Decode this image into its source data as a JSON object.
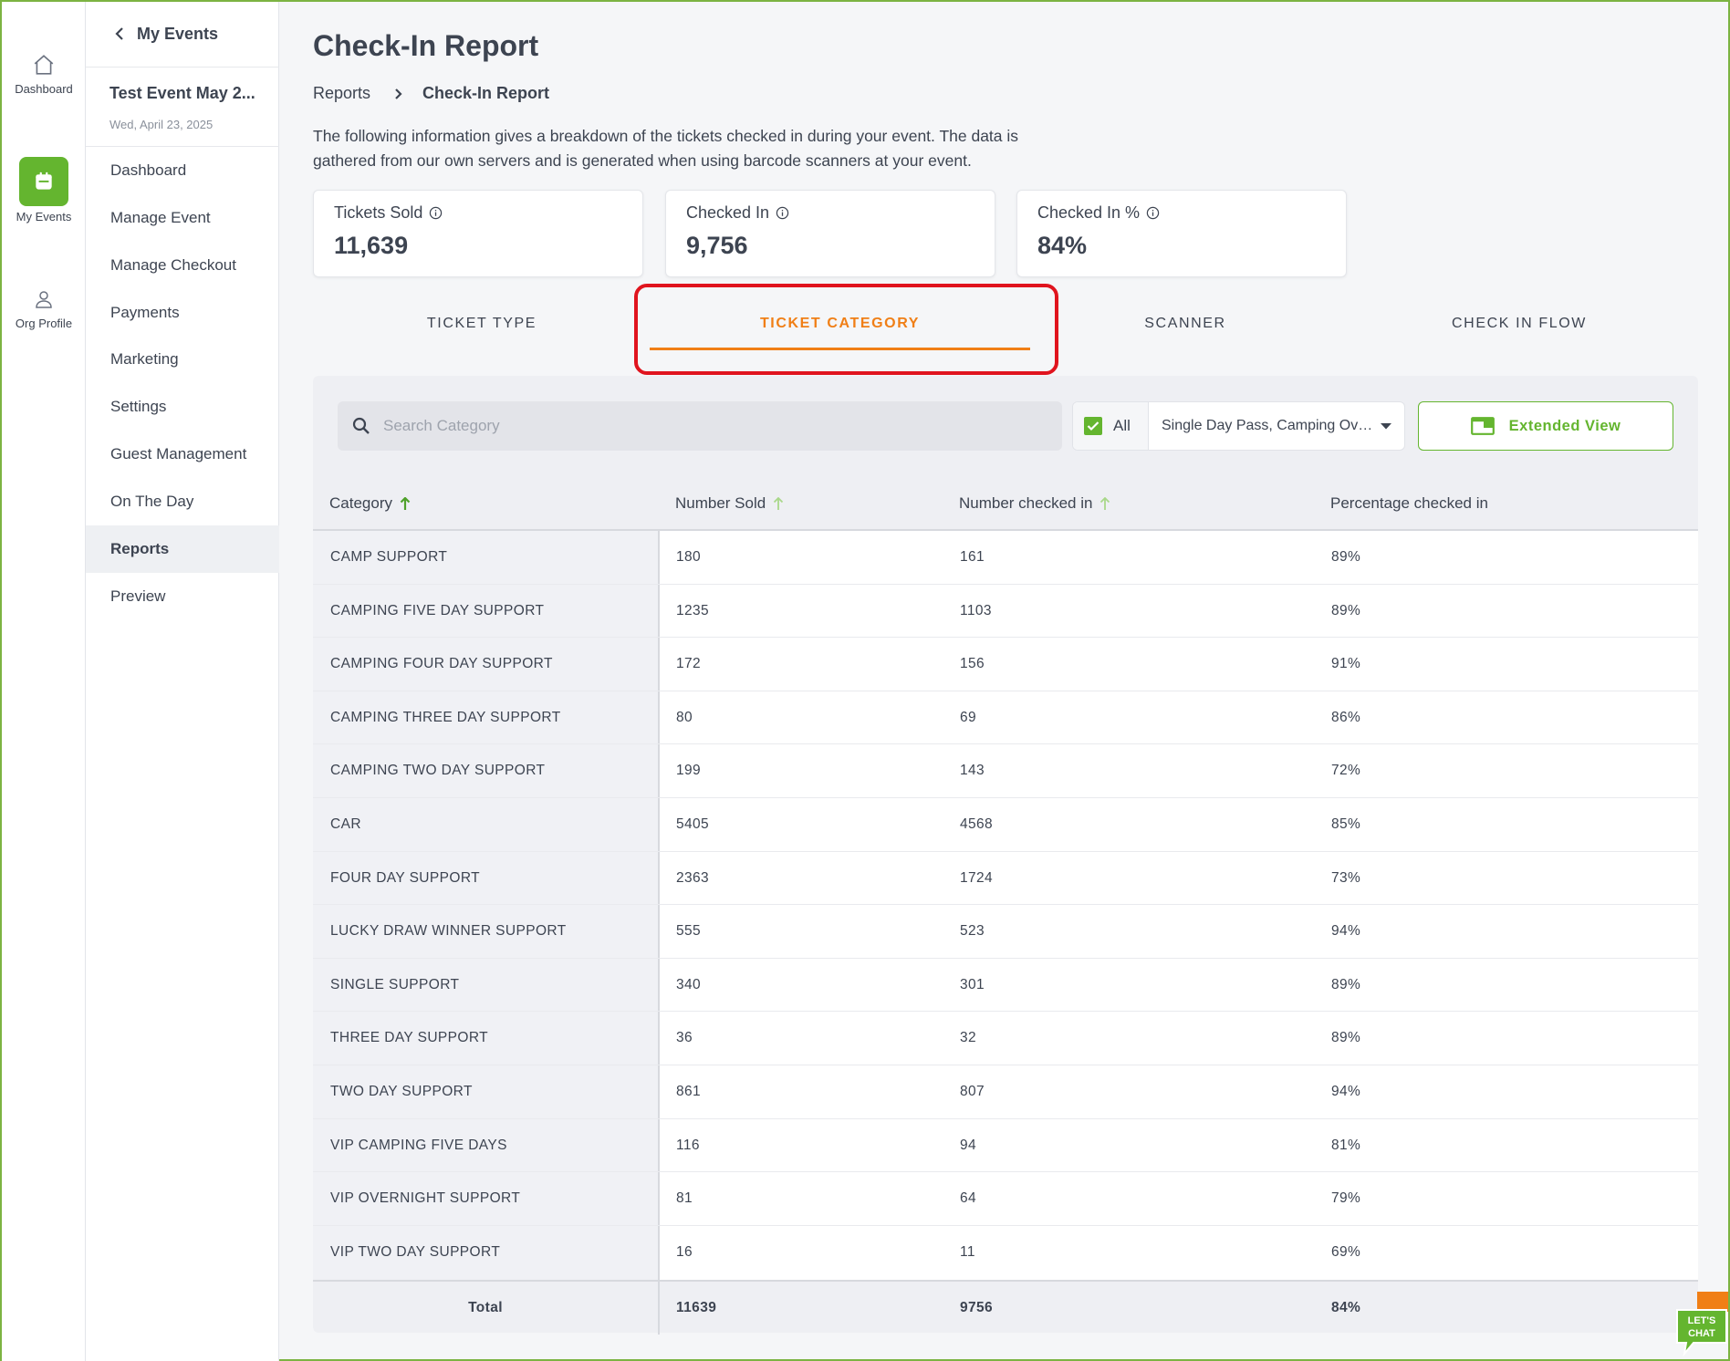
{
  "rail": {
    "items": [
      {
        "label": "Dashboard",
        "icon": "home-icon"
      },
      {
        "label": "My Events",
        "icon": "calendar-icon"
      },
      {
        "label": "Org Profile",
        "icon": "user-icon"
      }
    ]
  },
  "sidebar": {
    "back_label": "My Events",
    "event_name": "Test Event May 2...",
    "event_date": "Wed, April 23, 2025",
    "items": [
      {
        "label": "Dashboard"
      },
      {
        "label": "Manage Event"
      },
      {
        "label": "Manage Checkout"
      },
      {
        "label": "Payments"
      },
      {
        "label": "Marketing"
      },
      {
        "label": "Settings"
      },
      {
        "label": "Guest Management"
      },
      {
        "label": "On The Day"
      },
      {
        "label": "Reports"
      },
      {
        "label": "Preview"
      }
    ]
  },
  "page": {
    "title": "Check-In Report",
    "breadcrumb": {
      "parent": "Reports",
      "current": "Check-In Report"
    },
    "description": "The following information gives a breakdown of the tickets checked in during your event. The data is gathered from our own servers and is generated when using barcode scanners at your event."
  },
  "stats": [
    {
      "label": "Tickets Sold",
      "value": "11,639"
    },
    {
      "label": "Checked In",
      "value": "9,756"
    },
    {
      "label": "Checked In %",
      "value": "84%"
    }
  ],
  "tabs": [
    {
      "label": "TICKET TYPE"
    },
    {
      "label": "TICKET CATEGORY"
    },
    {
      "label": "SCANNER"
    },
    {
      "label": "CHECK IN FLOW"
    }
  ],
  "toolbar": {
    "search_placeholder": "Search Category",
    "filter_all_label": "All",
    "filter_selected": "Single Day Pass, Camping Over...",
    "extended_view_label": "Extended View"
  },
  "table": {
    "columns": [
      "Category",
      "Number Sold",
      "Number checked in",
      "Percentage checked in"
    ],
    "rows": [
      [
        "CAMP SUPPORT",
        "180",
        "161",
        "89%"
      ],
      [
        "CAMPING FIVE DAY SUPPORT",
        "1235",
        "1103",
        "89%"
      ],
      [
        "CAMPING FOUR DAY SUPPORT",
        "172",
        "156",
        "91%"
      ],
      [
        "CAMPING THREE DAY SUPPORT",
        "80",
        "69",
        "86%"
      ],
      [
        "CAMPING TWO DAY SUPPORT",
        "199",
        "143",
        "72%"
      ],
      [
        "CAR",
        "5405",
        "4568",
        "85%"
      ],
      [
        "FOUR DAY SUPPORT",
        "2363",
        "1724",
        "73%"
      ],
      [
        "LUCKY DRAW WINNER SUPPORT",
        "555",
        "523",
        "94%"
      ],
      [
        "SINGLE SUPPORT",
        "340",
        "301",
        "89%"
      ],
      [
        "THREE DAY SUPPORT",
        "36",
        "32",
        "89%"
      ],
      [
        "TWO DAY SUPPORT",
        "861",
        "807",
        "94%"
      ],
      [
        "VIP CAMPING FIVE DAYS",
        "116",
        "94",
        "81%"
      ],
      [
        "VIP OVERNIGHT SUPPORT",
        "81",
        "64",
        "79%"
      ],
      [
        "VIP TWO DAY SUPPORT",
        "16",
        "11",
        "69%"
      ]
    ],
    "total": {
      "label": "Total",
      "sold": "11639",
      "checked_in": "9756",
      "percentage": "84%"
    }
  },
  "chat": {
    "line1": "LET'S",
    "line2": "CHAT"
  },
  "colors": {
    "brand_green": "#64b52f",
    "accent_orange": "#f07f16",
    "highlight_red": "#e0141e"
  }
}
